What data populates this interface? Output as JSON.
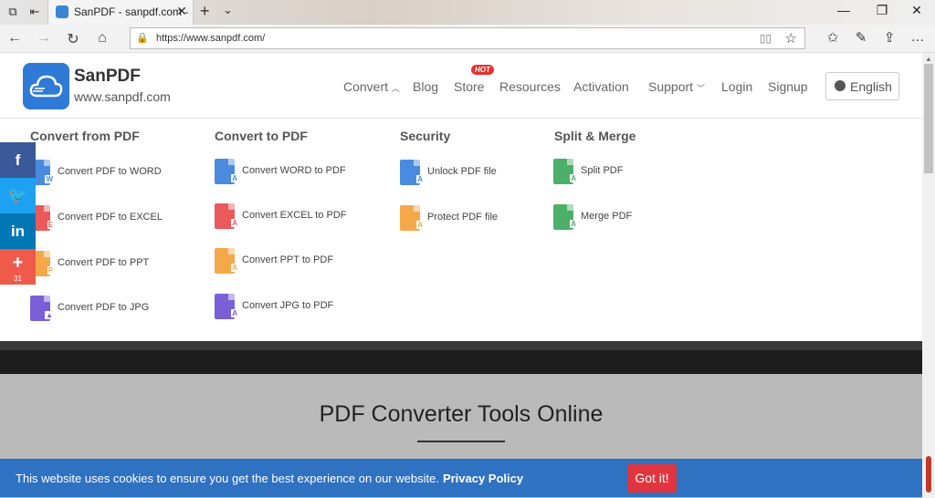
{
  "browser": {
    "tab_title": "SanPDF - sanpdf.com -",
    "url": "https://www.sanpdf.com/"
  },
  "site": {
    "brand_name": "SanPDF",
    "brand_url": "www.sanpdf.com",
    "brand_color": "#2f7ad6",
    "nav": {
      "convert": "Convert",
      "blog": "Blog",
      "store": "Store",
      "hot_badge": "HOT",
      "resources": "Resources",
      "activation": "Activation",
      "support": "Support",
      "login": "Login",
      "signup": "Signup",
      "language": "English"
    },
    "menu": {
      "from_pdf": {
        "title": "Convert from PDF",
        "items": [
          {
            "label": "Convert PDF to WORD",
            "icon": "word-file-icon",
            "color": "#4a8be0",
            "letter": "W"
          },
          {
            "label": "Convert PDF to EXCEL",
            "icon": "excel-file-icon",
            "color": "#ea5a5a",
            "letter": "E"
          },
          {
            "label": "Convert PDF to PPT",
            "icon": "ppt-file-icon",
            "color": "#f5a84a",
            "letter": "P"
          },
          {
            "label": "Convert PDF to JPG",
            "icon": "jpg-file-icon",
            "color": "#7b5fd6",
            "letter": "▲"
          }
        ]
      },
      "to_pdf": {
        "title": "Convert to PDF",
        "items": [
          {
            "label": "Convert WORD to PDF",
            "icon": "word-to-pdf-icon",
            "color": "#4a8be0",
            "letter": "A"
          },
          {
            "label": "Convert EXCEL to PDF",
            "icon": "excel-to-pdf-icon",
            "color": "#ea5a5a",
            "letter": "A"
          },
          {
            "label": "Convert PPT to PDF",
            "icon": "ppt-to-pdf-icon",
            "color": "#f5a84a",
            "letter": "A"
          },
          {
            "label": "Convert JPG to PDF",
            "icon": "jpg-to-pdf-icon",
            "color": "#7b5fd6",
            "letter": "A"
          }
        ]
      },
      "security": {
        "title": "Security",
        "items": [
          {
            "label": "Unlock PDF file",
            "icon": "unlock-pdf-icon",
            "color": "#4a8be0",
            "letter": "A"
          },
          {
            "label": "Protect PDF file",
            "icon": "protect-pdf-icon",
            "color": "#f5a84a",
            "letter": "A"
          }
        ]
      },
      "split_merge": {
        "title": "Split & Merge",
        "items": [
          {
            "label": "Split PDF",
            "icon": "split-pdf-icon",
            "color": "#4caf6a",
            "letter": "A"
          },
          {
            "label": "Merge PDF",
            "icon": "merge-pdf-icon",
            "color": "#4caf6a",
            "letter": "A"
          }
        ]
      }
    },
    "hero_title": "PDF Converter Tools Online",
    "social": {
      "share_count": "31",
      "facebook_color": "#3b5998",
      "twitter_color": "#1da1f2",
      "linkedin_color": "#0077b5",
      "more_color": "#f05a4a"
    },
    "cookie": {
      "text": "This website uses cookies to ensure you get the best experience on our website.",
      "link": "Privacy Policy",
      "button": "Got it!"
    }
  }
}
